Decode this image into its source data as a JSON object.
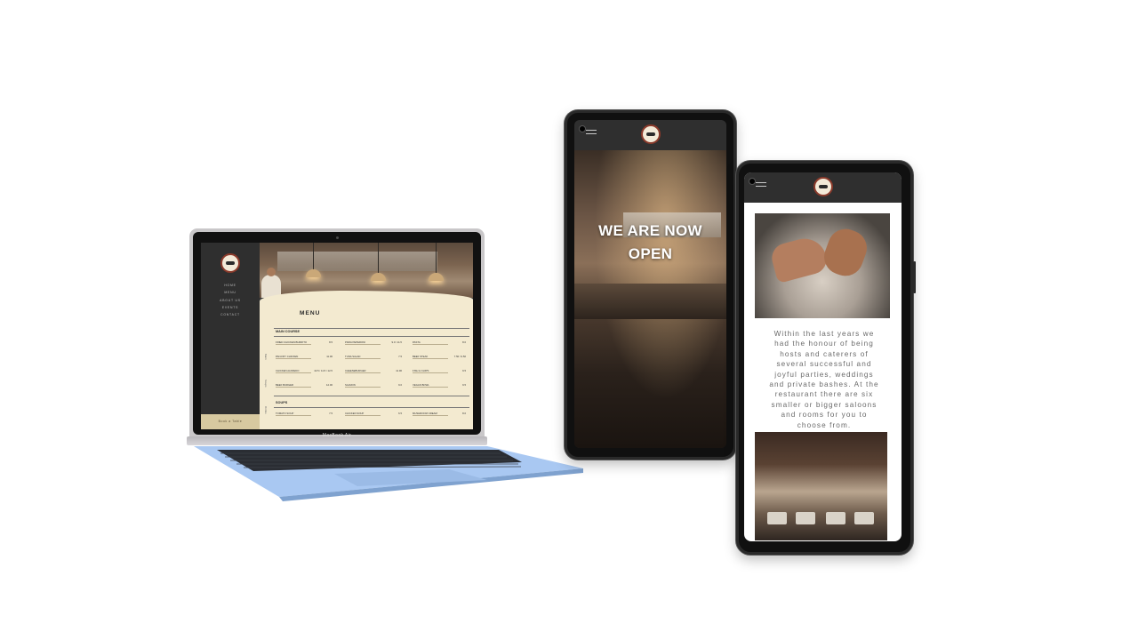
{
  "laptop": {
    "brand": "MacBook Air",
    "nav": [
      "Home",
      "Menu",
      "About Us",
      "Events",
      "Contact"
    ],
    "sidebar_footer": "Book a Table",
    "menu_title": "MENU",
    "sections": [
      {
        "title": "MAIN COURSE",
        "tab": "Main"
      },
      {
        "title": "SOUPS",
        "tab": "Soups"
      }
    ],
    "tabs": [
      "Main",
      "Soups",
      "Drinks"
    ],
    "main_items": [
      {
        "name": "FRIED CHICKEN BURRITO",
        "price": "8.5"
      },
      {
        "name": "PIZZA PEPERONI",
        "price": "9.0 / 11.5"
      },
      {
        "name": "PASTA",
        "price": "8.0"
      },
      {
        "name": "PAN-FRY CHICKEN",
        "price": "11.00"
      },
      {
        "name": "TUNA SALAD",
        "price": "7.5"
      },
      {
        "name": "BEEF STEAK",
        "price": "7.50 / 9.50"
      },
      {
        "name": "CHICKEN ALFREDO",
        "price": "10.5 / 11.5 / 12.5"
      },
      {
        "name": "CHEESEBURGER",
        "price": "11.00"
      },
      {
        "name": "FISH & CHIPS",
        "price": "9.5"
      },
      {
        "name": "BEEF BURGER",
        "price": "12.00"
      },
      {
        "name": "SALMON",
        "price": "9.0"
      },
      {
        "name": "VEGAN BOWL",
        "price": "9.5"
      }
    ],
    "soup_items": [
      {
        "name": "TOMATO SOUP",
        "price": "7.5"
      },
      {
        "name": "CHICKEN SOUP",
        "price": "6.5"
      },
      {
        "name": "MUSHROOM CREAM",
        "price": "8.0"
      }
    ]
  },
  "phone1": {
    "headline_line1": "WE ARE NOW",
    "headline_line2": "OPEN"
  },
  "phone2": {
    "paragraph": "Within the last years we had the honour of being hosts and caterers of several successful and joyful parties, weddings and private bashes. At the restaurant there are six smaller or bigger saloons and rooms for you to choose from."
  },
  "colors": {
    "sidebar": "#2f2f2f",
    "menu_paper": "#f3ead0",
    "logo_ring": "#8b3a2b",
    "laptop_deck": "#a9c8f2"
  },
  "icons": [
    "hamburger-menu-icon",
    "restaurant-logo-icon",
    "front-camera-icon"
  ]
}
